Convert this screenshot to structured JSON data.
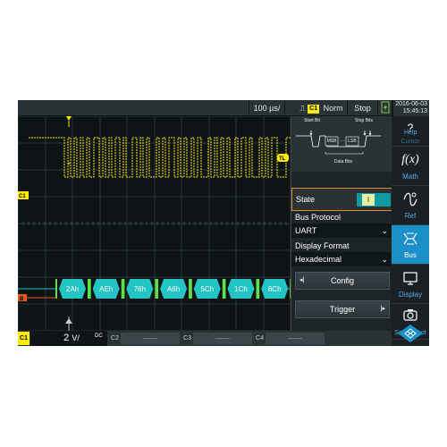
{
  "topbar": {
    "timebase": "100 µs/",
    "trigger_channel": "C1",
    "trigger_mode": "Norm",
    "run_state": "Stop",
    "date": "2016-06-03",
    "time": "15:45:13"
  },
  "scope": {
    "trigger_marker": "T",
    "ch1_marker": "C1",
    "bus_marker": "B",
    "level_marker": "TL",
    "decoded_frames": [
      "2Ah",
      "AEh",
      "76h",
      "A6h",
      "5Ch",
      "1Ch",
      "8Ch"
    ]
  },
  "panel": {
    "diagram": {
      "start_bit": "Start Bit",
      "stop_bits": "Stop Bits",
      "msb": "MSB",
      "dots": "···",
      "lsb": "LSB",
      "data_bits": "Data Bits"
    },
    "state_label": "State",
    "state_value": "I",
    "bus_protocol_label": "Bus Protocol",
    "bus_protocol_value": "UART",
    "display_format_label": "Display Format",
    "display_format_value": "Hexadecimal",
    "config_button": "Config",
    "trigger_button": "Trigger"
  },
  "menu": {
    "help": "Help",
    "help_partial": "Cursor",
    "math": "Math",
    "ref": "Ref",
    "bus": "Bus",
    "display": "Display",
    "screenshot": "Screenshot"
  },
  "channels": {
    "c1_label": "C1",
    "c1_scale": "2",
    "c1_unit": "V/",
    "c1_coupling": "DC",
    "c2_label": "C2",
    "c2_value": "——",
    "c3_label": "C3",
    "c3_value": "——",
    "c4_label": "C4",
    "c4_value": "——"
  },
  "colors": {
    "ch1": "#ffec00",
    "bus": "#22c4c4",
    "accent": "#1a8fc8",
    "highlight": "#d88a2c"
  }
}
